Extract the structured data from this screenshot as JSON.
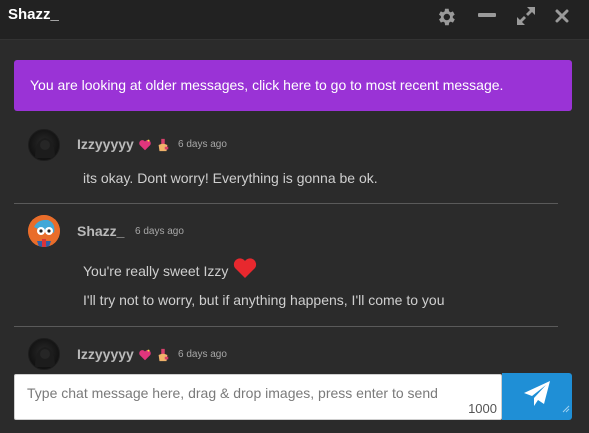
{
  "window": {
    "title": "Shazz_",
    "icons": [
      "gear-icon",
      "minimize-icon",
      "expand-icon",
      "close-icon"
    ]
  },
  "notice": {
    "text": "You are looking at older messages, click here to go to most recent message."
  },
  "messages": [
    {
      "username": "Izzyyyyy",
      "username_emojis": [
        "sparkling-heart-icon",
        "nail-polish-icon"
      ],
      "timestamp": "6 days ago",
      "lines": [
        "its okay. Dont worry! Everything is gonna be ok."
      ]
    },
    {
      "username": "Shazz_",
      "timestamp": "6 days ago",
      "lines": [
        "You're really sweet Izzy",
        "I'll try not to worry, but if anything happens, I'll come to you"
      ],
      "line_emojis": [
        "red-heart-icon"
      ]
    },
    {
      "username": "Izzyyyyy",
      "username_emojis": [
        "sparkling-heart-icon",
        "nail-polish-icon"
      ],
      "timestamp": "6 days ago",
      "lines": []
    }
  ],
  "composer": {
    "placeholder": "Type chat message here, drag & drop images, press enter to send",
    "char_remaining": "1000",
    "send_icon": "paper-plane-icon"
  },
  "colors": {
    "background": "#2b2b2b",
    "notice": "#9a33d6",
    "send_button": "#1f8fd6",
    "heart": "#e8282e"
  }
}
